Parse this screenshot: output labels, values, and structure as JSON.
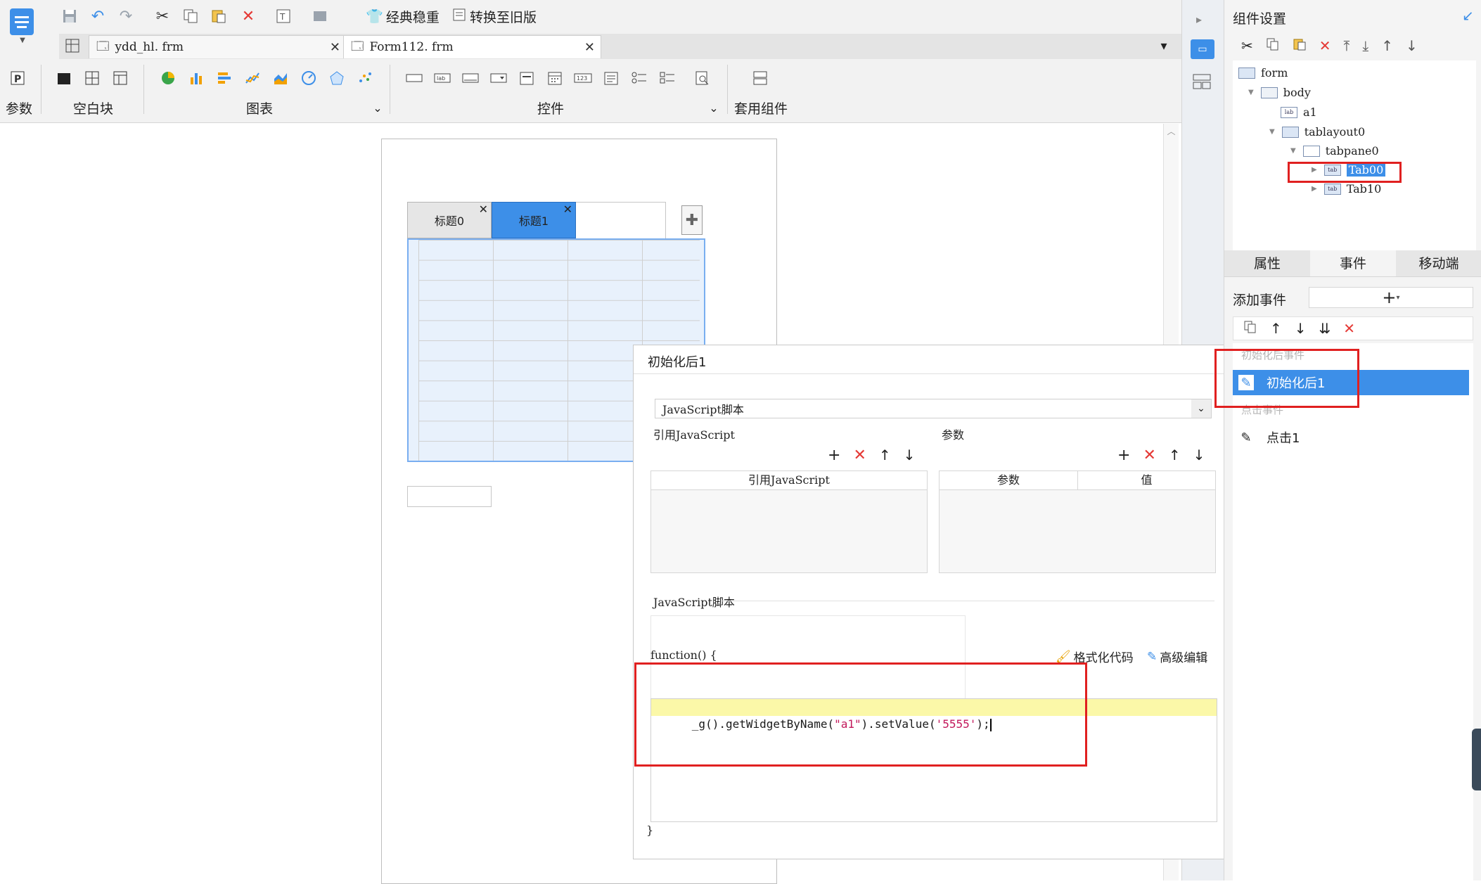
{
  "toolbar": {
    "classic_label": "经典稳重",
    "convert_label": "转换至旧版",
    "tabs": [
      {
        "label": "ydd_hl. frm"
      },
      {
        "label": "Form112. frm"
      }
    ],
    "groups": {
      "params": "参数",
      "blank_block": "空白块",
      "chart": "图表",
      "widgets": "控件",
      "suite": "套用组件"
    }
  },
  "canvas": {
    "tab0": "标题0",
    "tab1": "标题1"
  },
  "dialog": {
    "title": "初始化后1",
    "script_type": "JavaScript脚本",
    "ref_js_label": "引用JavaScript",
    "params_label": "参数",
    "ref_js_col": "引用JavaScript",
    "param_col": "参数",
    "value_col": "值",
    "script_label": "JavaScript脚本",
    "fn_open": "function() {",
    "format_code": "格式化代码",
    "advanced_edit": "高级编辑",
    "code_prefix": "_g().getWidgetByName(",
    "code_arg1": "\"a1\"",
    "code_mid": ").setValue(",
    "code_arg2": "'5555'",
    "code_suffix": ");",
    "fn_close": "}"
  },
  "right_panel": {
    "title": "组件设置",
    "tree": {
      "form": "form",
      "body": "body",
      "a1": "a1",
      "tablayout0": "tablayout0",
      "tabpane0": "tabpane0",
      "tab00": "Tab00",
      "tab10": "Tab10"
    },
    "prop_tabs": {
      "attr": "属性",
      "event": "事件",
      "mobile": "移动端"
    },
    "add_event": "添加事件",
    "events": {
      "after_init_group": "初始化后事件",
      "after_init_item": "初始化后1",
      "click_group": "点击事件",
      "click_item": "点击1"
    }
  },
  "colors": {
    "accent": "#3d8fe8",
    "highlight_annotation": "#e02020",
    "code_line_bg": "#fbf8a8"
  }
}
